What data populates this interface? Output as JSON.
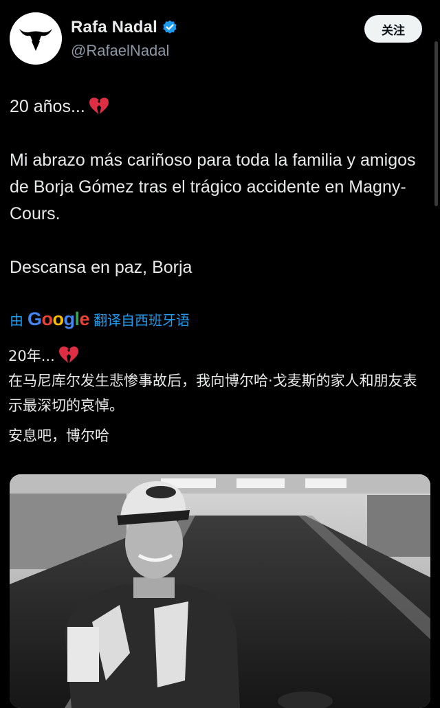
{
  "author": {
    "display_name": "Rafa Nadal",
    "handle": "@RafaelNadal",
    "verified": true,
    "avatar_icon": "bull-logo-icon"
  },
  "follow_button": {
    "label": "关注"
  },
  "tweet": {
    "line1": "20 años...",
    "line2": "Mi abrazo más cariñoso para toda la familia y amigos de Borja Gómez tras el  trágico accidente en Magny-Cours.",
    "line3": "Descansa en paz, Borja",
    "emoji": "broken-heart-icon"
  },
  "translation": {
    "prefix": "由",
    "provider": "Google",
    "suffix": "翻译自西班牙语",
    "line1": "20年...",
    "line2": "在马尼库尔发生悲惨事故后，我向博尔哈·戈麦斯的家人和朋友表示最深切的哀悼。",
    "line3": "安息吧，博尔哈"
  },
  "colors": {
    "background": "#000000",
    "text": "#e7e9ea",
    "secondary": "#8b98a5",
    "link": "#1d9bf0",
    "verified": "#1d9bf0"
  }
}
